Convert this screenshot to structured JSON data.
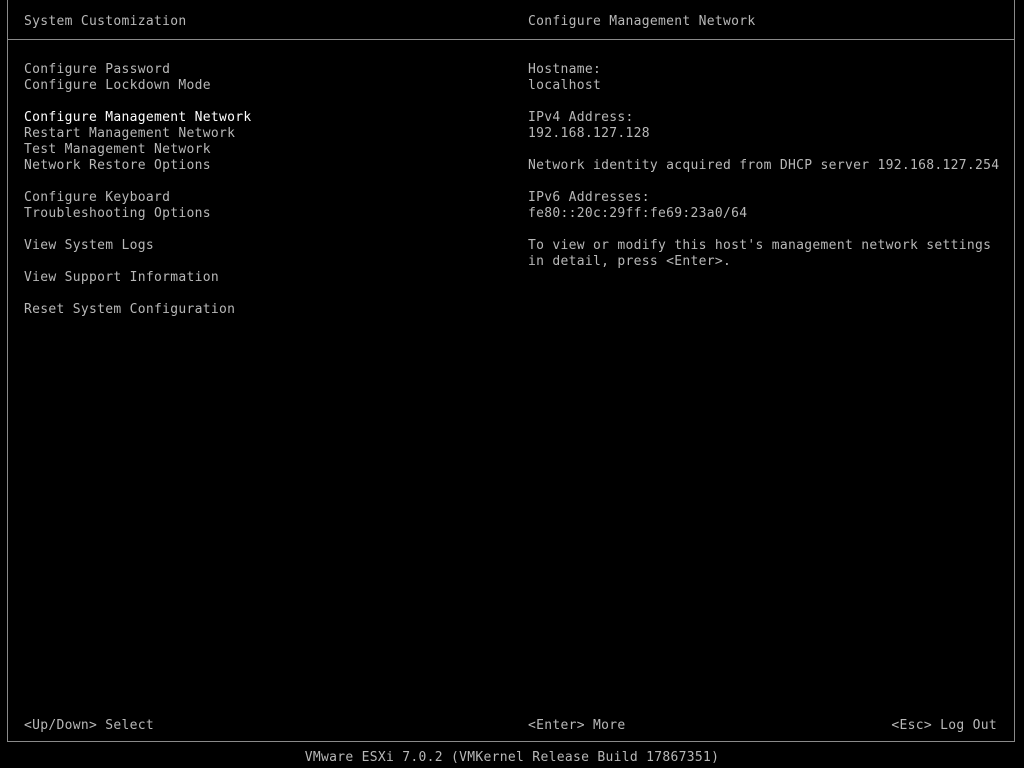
{
  "header": {
    "left_title": "System Customization",
    "right_title": "Configure Management Network"
  },
  "menu": {
    "items": [
      {
        "label": "Configure Password"
      },
      {
        "label": "Configure Lockdown Mode"
      },
      {
        "label": "Configure Management Network",
        "selected": true
      },
      {
        "label": "Restart Management Network"
      },
      {
        "label": "Test Management Network"
      },
      {
        "label": "Network Restore Options"
      },
      {
        "label": "Configure Keyboard"
      },
      {
        "label": "Troubleshooting Options"
      },
      {
        "label": "View System Logs"
      },
      {
        "label": "View Support Information"
      },
      {
        "label": "Reset System Configuration"
      }
    ]
  },
  "details": {
    "hostname_label": "Hostname:",
    "hostname_value": "localhost",
    "ipv4_label": "IPv4 Address:",
    "ipv4_value": "192.168.127.128",
    "dhcp_note": "Network identity acquired from DHCP server 192.168.127.254",
    "ipv6_label": "IPv6 Addresses:",
    "ipv6_value": "fe80::20c:29ff:fe69:23a0/64",
    "help_text": "To view or modify this host's management network settings in detail, press <Enter>."
  },
  "footer": {
    "left": "<Up/Down> Select",
    "middle": "<Enter> More",
    "right": "<Esc> Log Out"
  },
  "status_bar": {
    "text": "VMware ESXi 7.0.2 (VMKernel Release Build 17867351)"
  },
  "colors": {
    "background": "#000000",
    "text": "#b8b8b8",
    "selected_text": "#ffffff",
    "border": "#8a8a8a"
  }
}
